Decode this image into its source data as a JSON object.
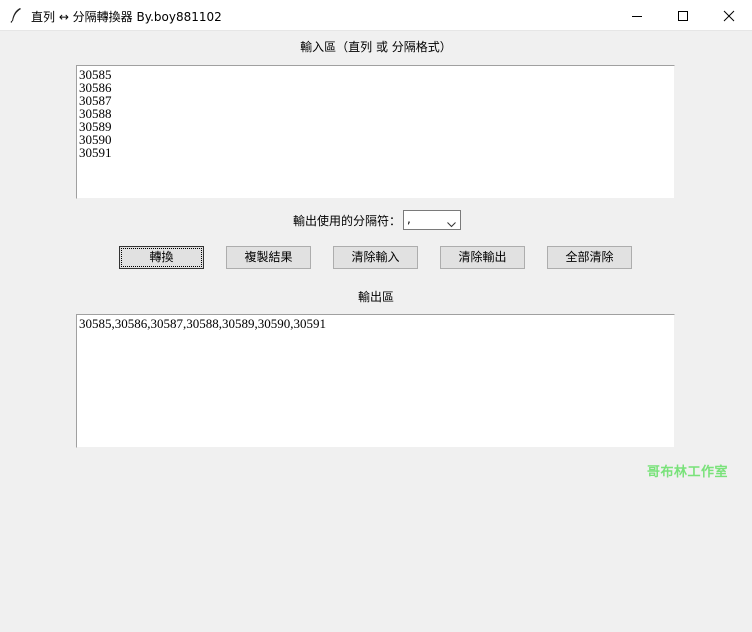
{
  "window": {
    "title": "直列 ↔ 分隔轉換器 By.boy881102"
  },
  "input": {
    "label": "輸入區（直列 或 分隔格式）",
    "lines": [
      "30585",
      "30586",
      "30587",
      "30588",
      "30589",
      "30590",
      "30591"
    ]
  },
  "separator": {
    "label": "輸出使用的分隔符：",
    "selected": ","
  },
  "buttons": {
    "convert": "轉換",
    "copy": "複製結果",
    "clear_input": "清除輸入",
    "clear_output": "清除輸出",
    "clear_all": "全部清除"
  },
  "output": {
    "label": "輸出區",
    "lines": [
      "30585,30586,30587,30588,30589,30590,30591"
    ]
  },
  "watermark": "哥布林工作室",
  "colors": {
    "window_bg": "#f0f0f0",
    "watermark": "#79e27a"
  },
  "icons": {
    "app": "feather-icon",
    "minimize": "minimize-icon",
    "maximize": "maximize-icon",
    "close": "close-icon",
    "dropdown": "chevron-down-icon"
  }
}
